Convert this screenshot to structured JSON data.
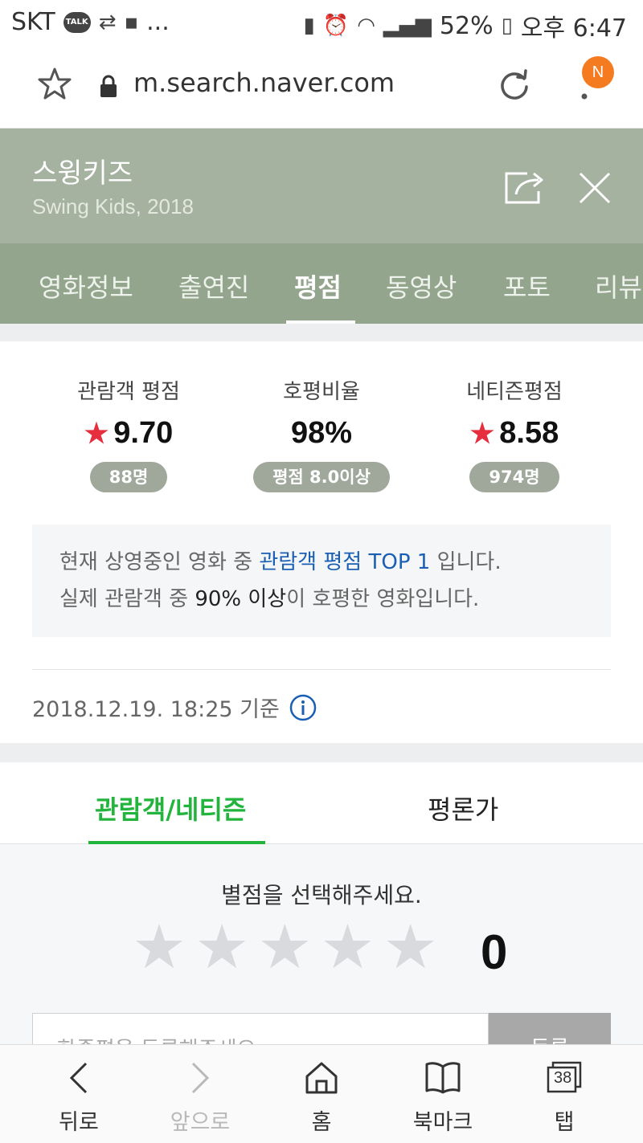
{
  "status_bar": {
    "carrier": "SKT",
    "talk_badge": "TALK",
    "more": "...",
    "battery": "52%",
    "time": "오후 6:47"
  },
  "address_bar": {
    "url": "m.search.naver.com",
    "notification_letter": "N",
    "badge_color": "#f47b20"
  },
  "movie": {
    "title": "스윙키즈",
    "subtitle": "Swing Kids, 2018",
    "header_color": "#a5b29f"
  },
  "tabs": [
    {
      "label": "영화정보"
    },
    {
      "label": "출연진"
    },
    {
      "label": "평점"
    },
    {
      "label": "동영상"
    },
    {
      "label": "포토"
    },
    {
      "label": "리뷰"
    }
  ],
  "active_tab": "평점",
  "ratings": {
    "audience": {
      "label": "관람객 평점",
      "value": "9.70",
      "count": "88명"
    },
    "favorable": {
      "label": "호평비율",
      "value": "98%",
      "note": "평점 8.0이상"
    },
    "netizen": {
      "label": "네티즌평점",
      "value": "8.58",
      "count": "974명"
    }
  },
  "info_box": {
    "line1_a": "현재 상영중인 영화 중 ",
    "line1_highlight": "관람객 평점 TOP 1",
    "line1_b": " 입니다.",
    "line2_a": "실제 관람객 중 ",
    "line2_highlight": "90% 이상",
    "line2_b": "이 호평한 영화입니다."
  },
  "timestamp": "2018.12.19. 18:25 기준",
  "review_tabs": [
    {
      "label": "관람객/네티즌"
    },
    {
      "label": "평론가"
    }
  ],
  "accent_green": "#22b43c",
  "star_picker": {
    "prompt": "별점을 선택해주세요.",
    "score": "0",
    "input_placeholder": "한줄평을 등록해주세요.",
    "submit_label": "등록"
  },
  "bottom_nav": {
    "back": "뒤로",
    "forward": "앞으로",
    "home": "홈",
    "bookmarks": "북마크",
    "tabs": "탭",
    "tab_count": "38"
  }
}
